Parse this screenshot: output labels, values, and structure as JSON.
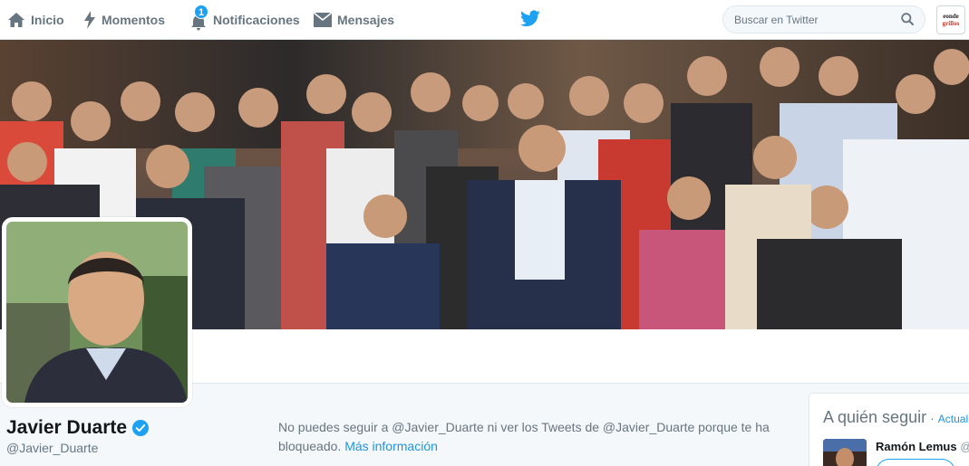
{
  "nav": {
    "home_label": "Inicio",
    "moments_label": "Momentos",
    "notifications_label": "Notificaciones",
    "notifications_count": "1",
    "messages_label": "Mensajes"
  },
  "search": {
    "placeholder": "Buscar en Twitter"
  },
  "account_avatar": {
    "line1": "eonde",
    "line2": "grillos"
  },
  "profile": {
    "name": "Javier Duarte",
    "handle": "@Javier_Duarte",
    "verified": true
  },
  "blocked_notice": {
    "text": "No puedes seguir a @Javier_Duarte ni ver los Tweets de @Javier_Duarte porque te ha bloqueado.",
    "link_text": "Más información"
  },
  "who_to_follow": {
    "title": "A quién seguir",
    "separator": "·",
    "refresh_label": "Actualiz",
    "suggestions": [
      {
        "name": "Ramón Lemus",
        "handle_fragment": "@"
      }
    ]
  },
  "colors": {
    "brand_blue": "#1da1f2",
    "link_blue": "#1b95e0",
    "nav_gray": "#66757f"
  }
}
